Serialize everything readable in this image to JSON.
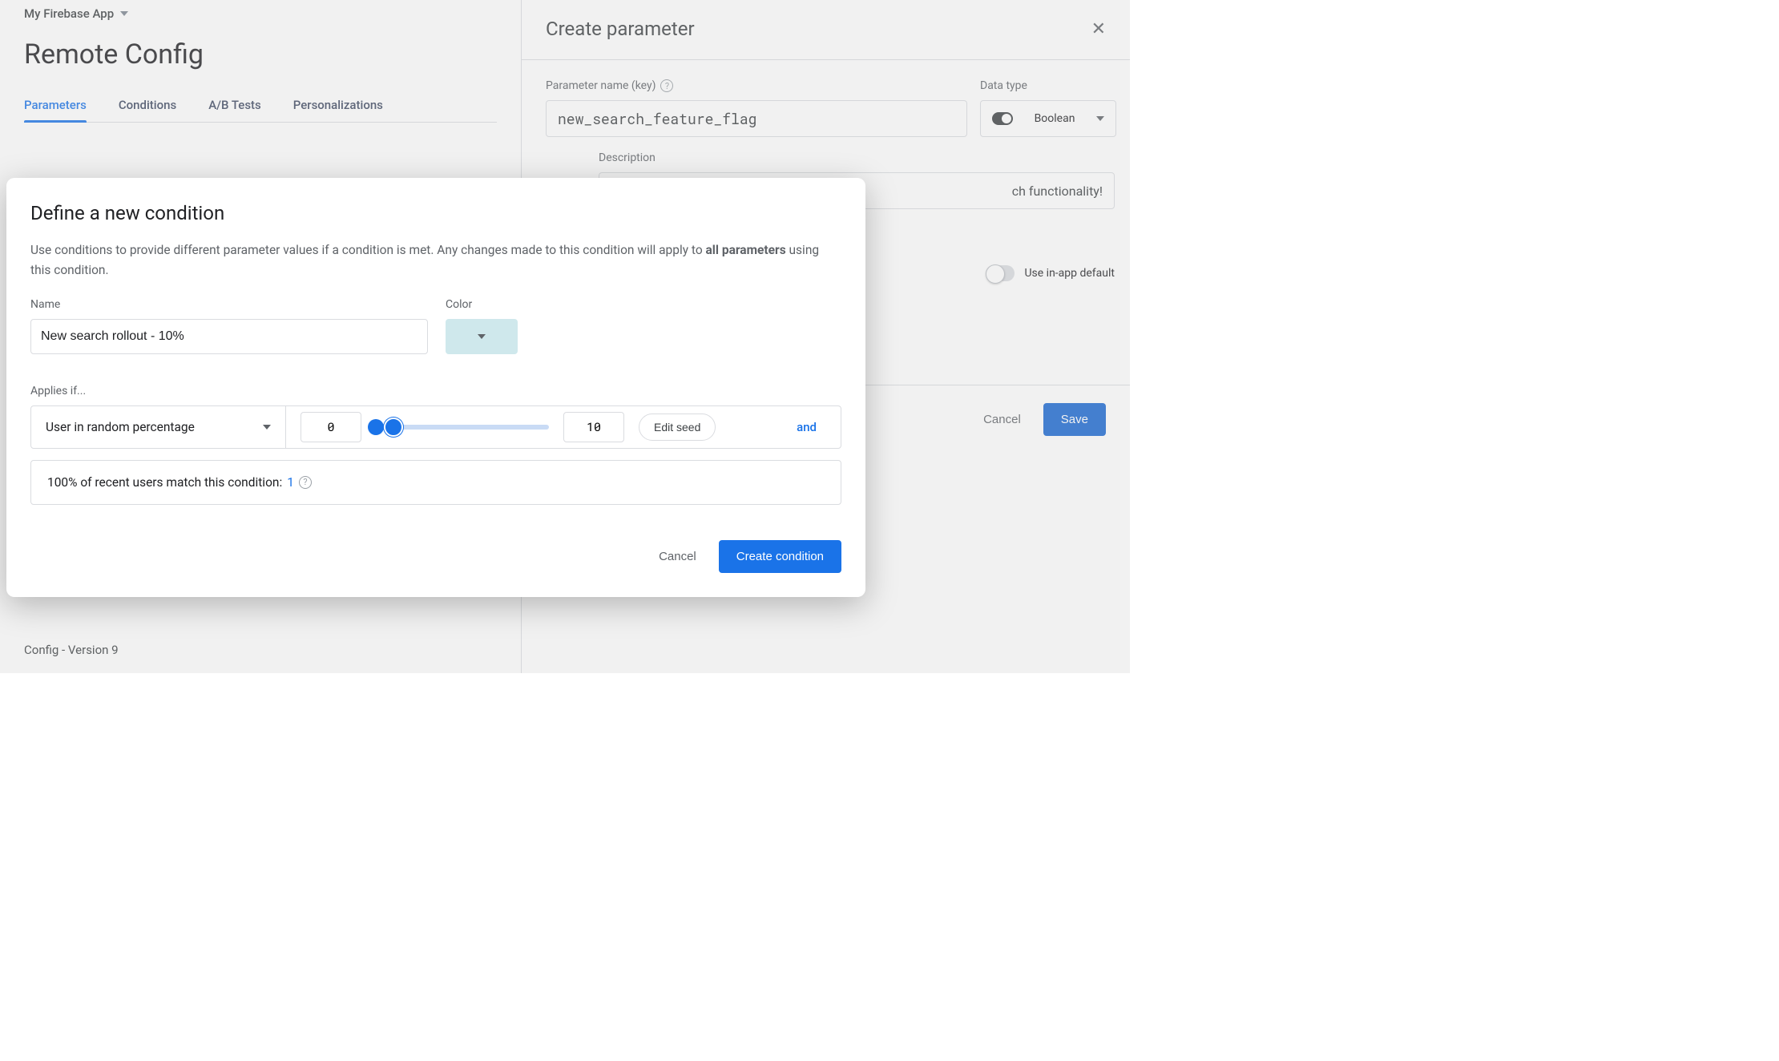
{
  "app_picker": {
    "name": "My Firebase App"
  },
  "page_title": "Remote Config",
  "tabs": [
    "Parameters",
    "Conditions",
    "A/B Tests",
    "Personalizations"
  ],
  "active_tab_index": 0,
  "config_version": "Config - Version 9",
  "side_panel": {
    "title": "Create parameter",
    "param_key_label": "Parameter name (key)",
    "param_key_value": "new_search_feature_flag",
    "data_type_label": "Data type",
    "data_type_value": "Boolean",
    "description_label": "Description",
    "description_visible": "ch functionality!",
    "use_default_label": "Use in-app default",
    "cancel": "Cancel",
    "save": "Save"
  },
  "modal": {
    "title": "Define a new condition",
    "desc_part1": "Use conditions to provide different parameter values if a condition is met. Any changes made to this condition will apply to ",
    "desc_bold": "all parameters",
    "desc_part2": " using this condition.",
    "name_label": "Name",
    "name_value": "New search rollout - 10%",
    "color_label": "Color",
    "color_value": "#cfe8ec",
    "applies_label": "Applies if...",
    "rule_type": "User in random percentage",
    "range_from": "0",
    "range_to": "10",
    "edit_seed": "Edit seed",
    "and": "and",
    "match_text": "100% of recent users match this condition: ",
    "match_count": "1",
    "cancel": "Cancel",
    "create": "Create condition"
  }
}
